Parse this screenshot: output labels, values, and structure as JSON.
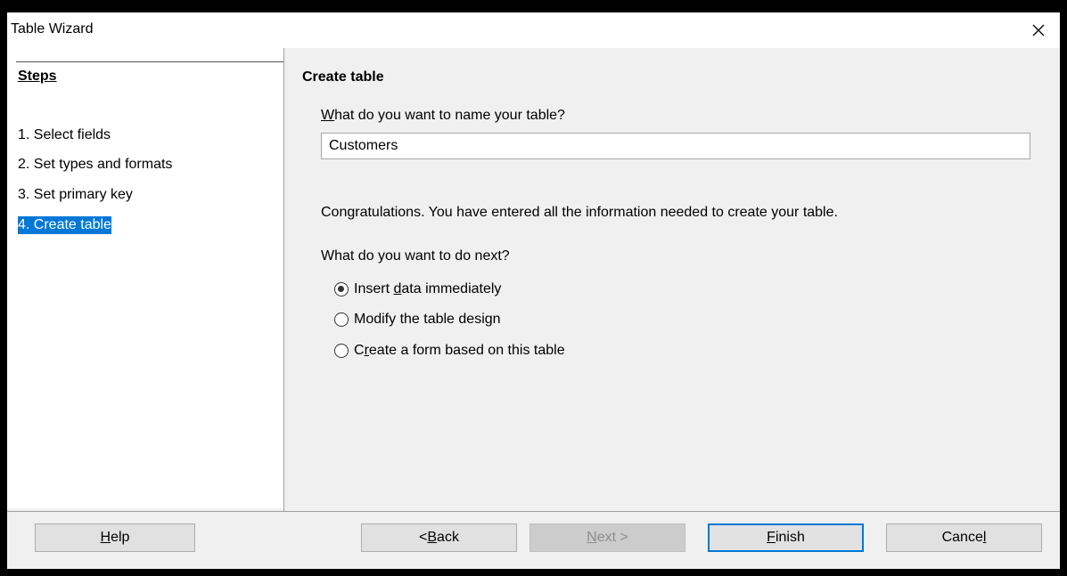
{
  "window": {
    "title": "Table Wizard",
    "close_icon": "close-icon"
  },
  "steps": {
    "header": "Steps",
    "items": [
      {
        "label": "1. Select fields",
        "selected": false
      },
      {
        "label": "2. Set types and formats",
        "selected": false
      },
      {
        "label": "3. Set primary key",
        "selected": false
      },
      {
        "label": "4. Create table",
        "selected": true
      }
    ]
  },
  "main": {
    "title": "Create table",
    "name_question_prefix": "W",
    "name_question_rest": "hat do you want to name your table?",
    "name_value": "Customers",
    "congrats": "Congratulations. You have entered all the information needed to create your table.",
    "next_question": "What do you want to do next?",
    "options": [
      {
        "pre": "Insert ",
        "key": "d",
        "post": "ata immediately",
        "checked": true
      },
      {
        "pre": "Modify the table desi",
        "key": "g",
        "post": "n",
        "checked": false
      },
      {
        "pre": "C",
        "key": "r",
        "post": "eate a form based on this table",
        "checked": false
      }
    ]
  },
  "buttons": {
    "help": {
      "key": "H",
      "rest": "elp"
    },
    "back": {
      "pre": "< ",
      "key": "B",
      "rest": "ack"
    },
    "next": {
      "key": "N",
      "rest": "ext >"
    },
    "finish": {
      "key": "F",
      "rest": "inish"
    },
    "cancel": {
      "pre": "Cance",
      "key": "l"
    }
  },
  "colors": {
    "selection": "#0078d7",
    "default_button_border": "#0078d7"
  }
}
